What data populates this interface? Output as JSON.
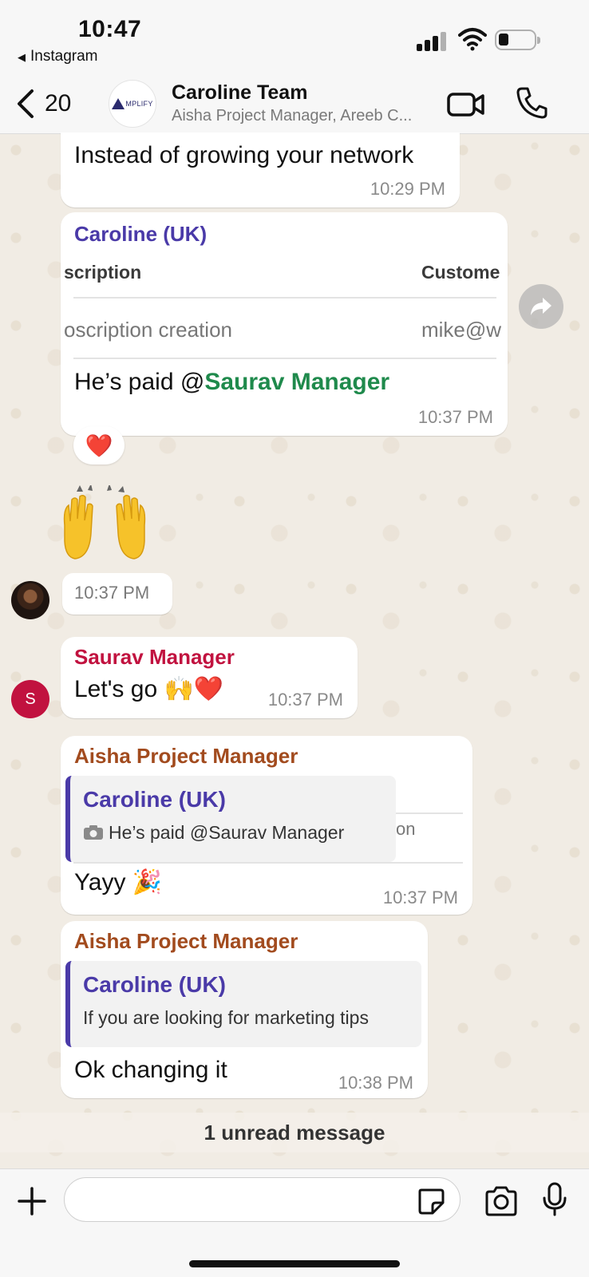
{
  "status_bar": {
    "time": "10:47",
    "back_app": "Instagram"
  },
  "header": {
    "back_count": "20",
    "group_logo_text": "MPLIFY",
    "title": "Caroline Team",
    "subtitle": "Aisha Project Manager, Areeb C..."
  },
  "messages": {
    "m1": {
      "text": "Instead of growing your network",
      "time": "10:29 PM"
    },
    "m2": {
      "sender": "Caroline (UK)",
      "table_header_left": "scription",
      "table_header_right": "Custome",
      "table_cell_left": "oscription creation",
      "table_cell_right": "mike@w",
      "text_prefix": "He’s paid @",
      "mention": "Saurav Manager",
      "time": "10:37 PM",
      "reaction": "❤️"
    },
    "m3": {
      "emoji": "🙌",
      "time": "10:37 PM"
    },
    "m4": {
      "sender": "Saurav Manager",
      "avatar_letter": "S",
      "text": "Let's go 🙌❤️",
      "time": "10:37 PM"
    },
    "m5": {
      "sender": "Aisha Project Manager",
      "quote_sender": "Caroline (UK)",
      "quote_text": "He’s paid @Saurav Manager",
      "behind_text": "on",
      "text": "Yayy 🎉",
      "time": "10:37 PM"
    },
    "m6": {
      "sender": "Aisha Project Manager",
      "quote_sender": "Caroline (UK)",
      "quote_text": "If you are looking for marketing tips",
      "text": "Ok changing it",
      "time": "10:38 PM"
    }
  },
  "unread_banner": "1 unread message",
  "composer": {
    "placeholder": ""
  },
  "colors": {
    "accent_purple": "#4a3aa8",
    "mention_green": "#1f8a4c",
    "saurav_red": "#c1123f",
    "aisha_brown": "#a24b1e"
  },
  "icons": [
    "back-chevron-icon",
    "video-call-icon",
    "phone-icon",
    "forward-icon",
    "plus-icon",
    "sticker-icon",
    "camera-icon",
    "microphone-icon"
  ]
}
